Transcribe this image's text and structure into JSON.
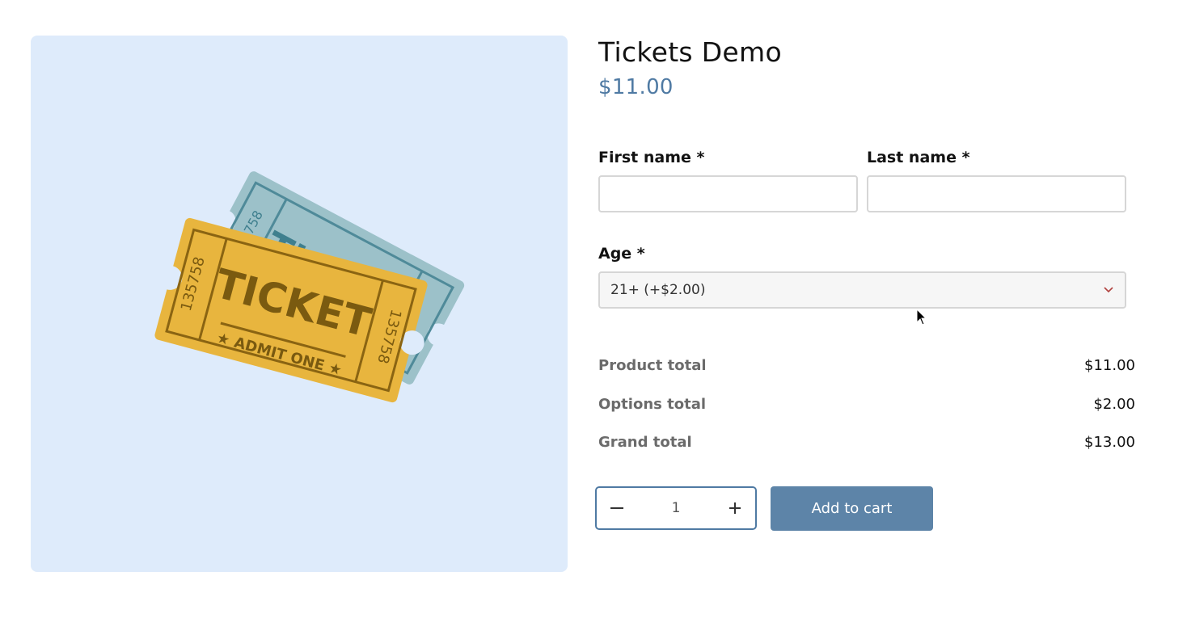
{
  "product": {
    "title": "Tickets Demo",
    "price": "$11.00",
    "image": {
      "alt": "tickets-illustration",
      "back_ticket": {
        "word": "TICKET",
        "serial": "135758",
        "color": "#9cc1c9"
      },
      "front_ticket": {
        "word": "TICKET",
        "subtext": "★ ADMIT ONE ★",
        "serial": "135758",
        "color": "#e8b53e"
      }
    }
  },
  "form": {
    "first_name_label": "First name *",
    "first_name_value": "",
    "last_name_label": "Last name *",
    "last_name_value": "",
    "age_label": "Age *",
    "age_selected": "21+ (+$2.00)"
  },
  "totals": {
    "product_total_label": "Product total",
    "product_total_value": "$11.00",
    "options_total_label": "Options total",
    "options_total_value": "$2.00",
    "grand_total_label": "Grand total",
    "grand_total_value": "$13.00"
  },
  "quantity": {
    "value": "1"
  },
  "cart": {
    "add_label": "Add to cart"
  },
  "colors": {
    "accent": "#4f7aa3",
    "button_bg": "#5d84a8",
    "media_bg": "#deebfb"
  },
  "icons": [
    "minus-icon",
    "plus-icon",
    "chevron-down-icon",
    "mouse-cursor-icon"
  ]
}
